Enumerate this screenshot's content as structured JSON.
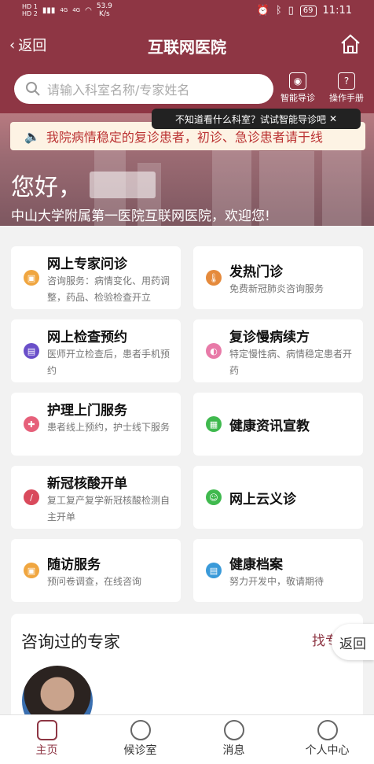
{
  "status_bar": {
    "sim1": "HD 1",
    "sim2": "HD 2",
    "network1": "4G",
    "network2": "4G",
    "speed_value": "53.9",
    "speed_unit": "K/s",
    "battery": "69",
    "time": "11:11"
  },
  "nav": {
    "back_label": "返回",
    "title": "互联网医院"
  },
  "search": {
    "placeholder": "请输入科室名称/专家姓名"
  },
  "tools": {
    "smart_guide": "智能导诊",
    "manual": "操作手册"
  },
  "tooltip": {
    "text": "不知道看什么科室？试试智能导诊吧"
  },
  "banner": {
    "notice": "我院病情稳定的复诊患者，初诊、急诊患者请于线",
    "greeting": "您好，",
    "subtitle": "中山大学附属第一医院互联网医院，欢迎您!"
  },
  "services": [
    {
      "title": "网上专家问诊",
      "desc": "咨询服务：病情变化、用药调整，药品、检验检查开立",
      "icon": "consult-icon",
      "color": "#f0a640"
    },
    {
      "title": "发热门诊",
      "desc": "免费新冠肺炎咨询服务",
      "icon": "thermometer-icon",
      "color": "#e58a3c"
    },
    {
      "title": "网上检查预约",
      "desc": "医师开立检查后，患者手机预约",
      "icon": "calendar-icon",
      "color": "#6a4fc9"
    },
    {
      "title": "复诊慢病续方",
      "desc": "特定慢性病、病情稳定患者开药",
      "icon": "pill-icon",
      "color": "#e87aa8"
    },
    {
      "title": "护理上门服务",
      "desc": "患者线上预约，护士线下服务",
      "icon": "nurse-icon",
      "color": "#e6607a"
    },
    {
      "title": "健康资讯宣教",
      "desc": "",
      "icon": "news-icon",
      "color": "#3fb94e"
    },
    {
      "title": "新冠核酸开单",
      "desc": "复工复产复学新冠核酸检测自主开单",
      "icon": "test-tube-icon",
      "color": "#d94a5c"
    },
    {
      "title": "网上云义诊",
      "desc": "",
      "icon": "smile-icon",
      "color": "#3fb94e"
    },
    {
      "title": "随访服务",
      "desc": "预问卷调查，在线咨询",
      "icon": "followup-icon",
      "color": "#f0a640"
    },
    {
      "title": "健康档案",
      "desc": "努力开发中，敬请期待",
      "icon": "record-icon",
      "color": "#3a9ad9"
    }
  ],
  "experts": {
    "heading": "咨询过的专家",
    "find_link": "找专家"
  },
  "float_back": "返回",
  "tabs": [
    {
      "label": "主页",
      "icon": "home-icon"
    },
    {
      "label": "候诊室",
      "icon": "waiting-room-icon"
    },
    {
      "label": "消息",
      "icon": "message-icon"
    },
    {
      "label": "个人中心",
      "icon": "profile-icon"
    }
  ],
  "colors": {
    "brand": "#8e3644",
    "notice_text": "#b33333",
    "notice_bg": "#fdf3e4"
  }
}
